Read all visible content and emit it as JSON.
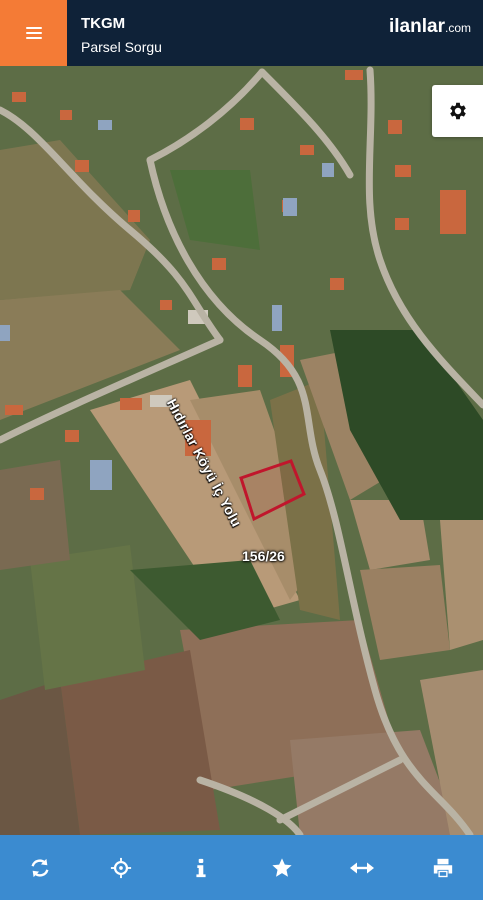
{
  "header": {
    "title": "TKGM",
    "subtitle": "Parsel Sorgu",
    "brand_name": "ilanlar",
    "brand_suffix": ".com",
    "accent_color": "#f47b36",
    "background_color": "#0f2238"
  },
  "map": {
    "road_label": "Hıdırlar Köyü İç Yolu",
    "parcel_label": "156/26",
    "parcel_outline_color": "#c0162c"
  },
  "controls": {
    "settings_icon": "gear-icon",
    "menu_icon": "hamburger-icon"
  },
  "toolbar": {
    "background_color": "#3b8bd0",
    "icons": [
      "refresh-icon",
      "crosshair-icon",
      "info-icon",
      "star-icon",
      "arrows-horizontal-icon",
      "print-icon"
    ]
  }
}
